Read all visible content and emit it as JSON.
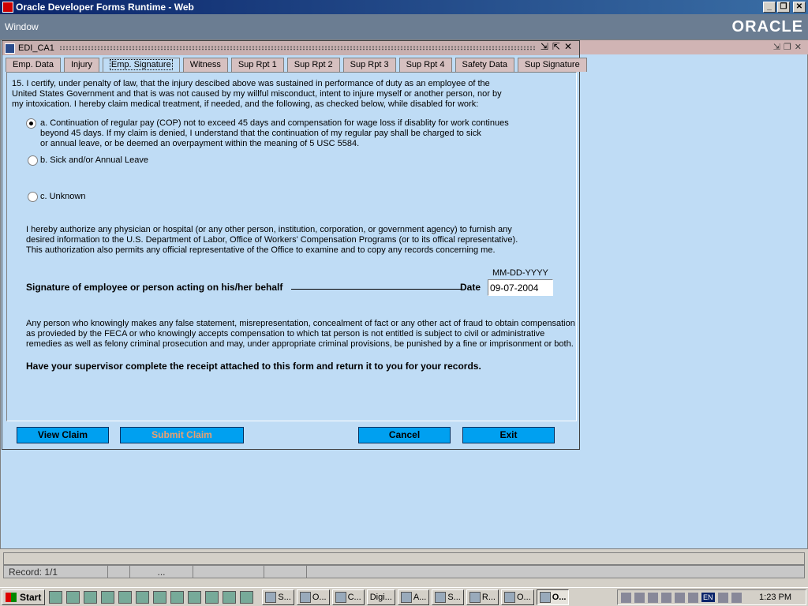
{
  "app": {
    "title": "Oracle Developer Forms Runtime - Web",
    "menu_window": "Window",
    "logo": "ORACLE"
  },
  "form": {
    "window_title": "EDI_CA1"
  },
  "tabs": [
    "Emp. Data",
    "Injury",
    "Emp. Signature",
    "Witness",
    "Sup Rpt 1",
    "Sup Rpt 2",
    "Sup Rpt 3",
    "Sup Rpt 4",
    "Safety Data",
    "Sup Signature"
  ],
  "active_tab": "Emp. Signature",
  "content": {
    "certify": "15. I certify, under penalty of law, that the injury descibed above was sustained in performance of duty as an employee of the\nUnited States Government and that is was not caused by my willful misconduct, intent to injure myself or another person, nor by\nmy intoxication.  I hereby claim medical treatment, if needed, and the following, as checked below, while disabled for work:",
    "option_a": "a. Continuation of regular pay (COP) not to exceed 45 days and compensation for wage loss if disablity for work continues\n    beyond 45 days.  If my claim is denied, I understand that the continuation of my regular pay shall be charged to sick\n    or annual leave, or be deemed an overpayment within the meaning of 5 USC 5584.",
    "option_b": "b. Sick and/or Annual Leave",
    "option_c": "c. Unknown",
    "selected_option": "a",
    "authorize": "I hereby authorize any physician or hospital (or any other person, institution, corporation, or government agency) to furnish any\ndesired information to the U.S. Department of Labor, Office of Workers' Compensation Programs (or to its offical representative).\nThis authorization also permits any official representative of the Office to examine and to copy any records concerning me.",
    "date_format": "MM-DD-YYYY",
    "signature_label": "Signature of employee or person acting on his/her behalf",
    "date_label": "Date",
    "date_value": "09-07-2004",
    "fraud_warning": "Any person who knowingly makes any false statement, misrepresentation, concealment of fact or any other act of fraud to obtain compensation\nas provieded by the FECA or who knowingly accepts compensation to which tat person is not entitled is subject to civil or administrative\nremedies as well as felony criminal prosecution and may, under appropriate criminal provisions, be punished by a fine or imprisonment or both.",
    "supervisor_note": "Have your supervisor complete the receipt attached to this form and return it to you for your records."
  },
  "buttons": {
    "view_claim": "View Claim",
    "submit_claim": "Submit Claim",
    "cancel": "Cancel",
    "exit": "Exit"
  },
  "status": {
    "record": "Record: 1/1",
    "ellipsis": "..."
  },
  "taskbar": {
    "start": "Start",
    "tasks": [
      "S...",
      "O...",
      "C...",
      "Digi...",
      "A...",
      "S...",
      "R...",
      "O...",
      "O..."
    ],
    "lang": "EN",
    "clock": "1:23 PM"
  },
  "colors": {
    "title_bar": "#0a246a",
    "canvas": "#bfdcf5",
    "button": "#00a0f0",
    "menubar": "#6b7d92"
  }
}
